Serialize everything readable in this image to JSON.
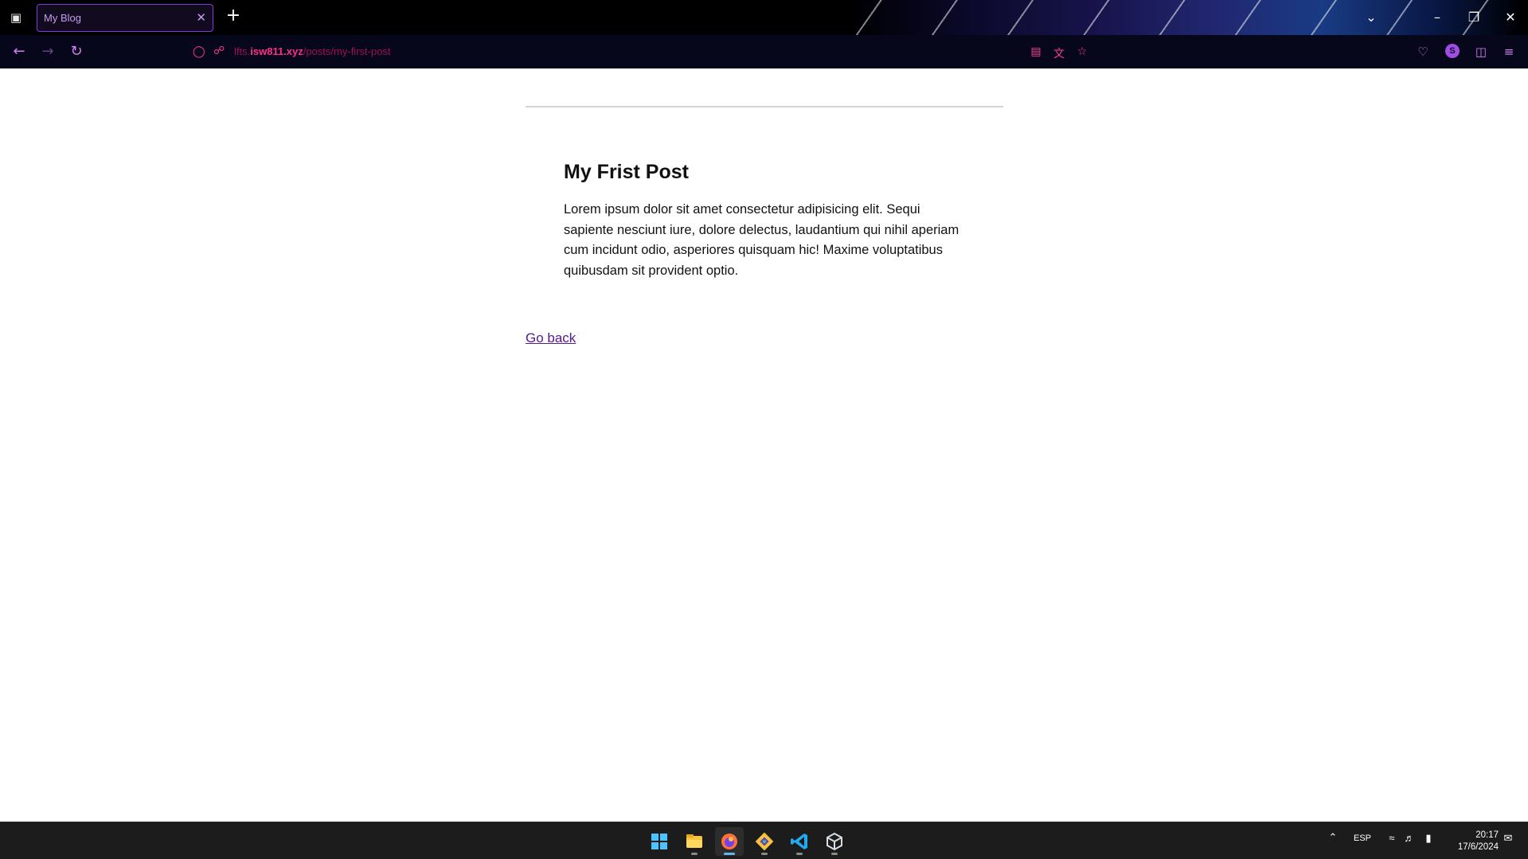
{
  "browser": {
    "tab": {
      "title": "My Blog"
    },
    "url": {
      "subdomain": "lfts.",
      "domain": "isw811.xyz",
      "path": "/posts/my-first-post"
    }
  },
  "post": {
    "title": "My Frist Post",
    "body": "Lorem ipsum dolor sit amet consectetur adipisicing elit. Sequi sapiente nesciunt iure, dolore delectus, laudantium qui nihil aperiam cum incidunt odio, asperiores quisquam hic! Maxime voluptatibus quibusdam sit provident optio.",
    "back_link": "Go back"
  },
  "taskbar": {
    "apps": [
      "start-icon",
      "file-explorer-icon",
      "firefox-icon",
      "git-icon",
      "vscode-icon",
      "virtualbox-icon"
    ],
    "language": "ESP",
    "time": "20:17",
    "date": "17/6/2024"
  },
  "colors": {
    "accent": "#ff2f86",
    "tab_border": "#7b3ed6",
    "link_visited": "#551a8b"
  }
}
